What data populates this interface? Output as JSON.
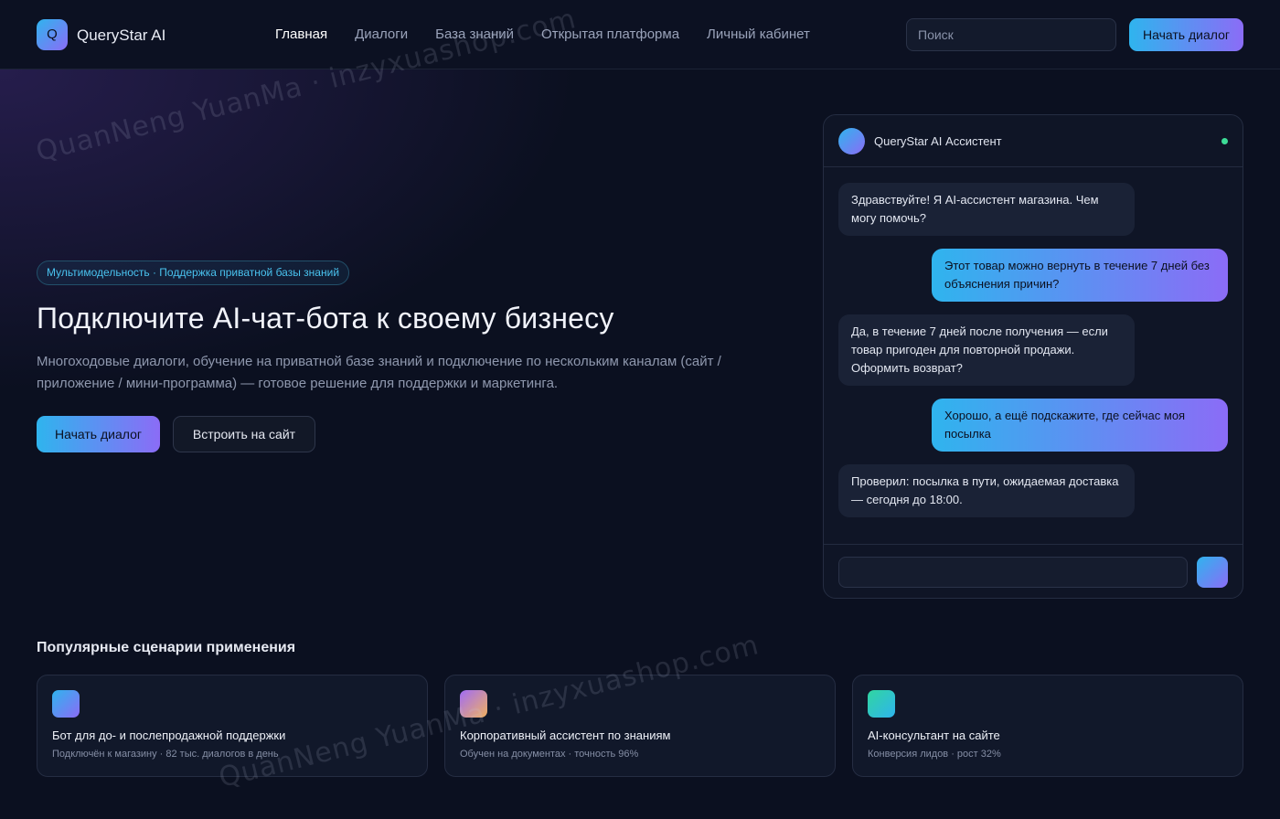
{
  "header": {
    "logo_letter": "Q",
    "brand": "QueryStar AI",
    "nav": [
      {
        "label": "Главная",
        "active": true
      },
      {
        "label": "Диалоги",
        "active": false
      },
      {
        "label": "База знаний",
        "active": false
      },
      {
        "label": "Открытая платформа",
        "active": false
      },
      {
        "label": "Личный кабинет",
        "active": false
      }
    ],
    "search_placeholder": "Поиск",
    "cta": "Начать диалог"
  },
  "hero": {
    "badge": "Мультимодельность · Поддержка приватной базы знаний",
    "title": "Подключите AI-чат-бота к своему бизнесу",
    "description": "Многоходовые диалоги, обучение на приватной базе знаний и подключение по нескольким каналам (сайт / приложение / мини-программа) — готовое решение для поддержки и маркетинга.",
    "primary_button": "Начать диалог",
    "secondary_button": "Встроить на сайт"
  },
  "chat": {
    "assistant_name": "QueryStar AI Ассистент",
    "status_color": "#3ddc97",
    "messages": [
      {
        "role": "bot",
        "text": "Здравствуйте! Я AI-ассистент магазина. Чем могу помочь?"
      },
      {
        "role": "user",
        "text": "Этот товар можно вернуть в течение 7 дней без объяснения причин?"
      },
      {
        "role": "bot",
        "text": "Да, в течение 7 дней после получения — если товар пригоден для повторной продажи. Оформить возврат?"
      },
      {
        "role": "user",
        "text": "Хорошо, а ещё подскажите, где сейчас моя посылка"
      },
      {
        "role": "bot",
        "text": "Проверил: посылка в пути, ожидаемая доставка — сегодня до 18:00."
      }
    ],
    "input_placeholder": ""
  },
  "scenarios": {
    "title": "Популярные сценарии применения",
    "cards": [
      {
        "title": "Бот для до- и послепродажной поддержки",
        "subtitle": "Подключён к магазину · 82 тыс. диалогов в день",
        "icon_colors": [
          "#2fb4ee",
          "#8b6cf6"
        ]
      },
      {
        "title": "Корпоративный ассистент по знаниям",
        "subtitle": "Обучен на документах · точность 96%",
        "icon_colors": [
          "#a06cf6",
          "#f0b060"
        ]
      },
      {
        "title": "AI-консультант на сайте",
        "subtitle": "Конверсия лидов · рост 32%",
        "icon_colors": [
          "#30d6a0",
          "#2fb4ee"
        ]
      }
    ]
  },
  "watermark": "QuanNeng YuanMa · inzyxuashop.com",
  "colors": {
    "accent_start": "#2fb4ee",
    "accent_end": "#8b6cf6",
    "background": "#0b1020"
  }
}
